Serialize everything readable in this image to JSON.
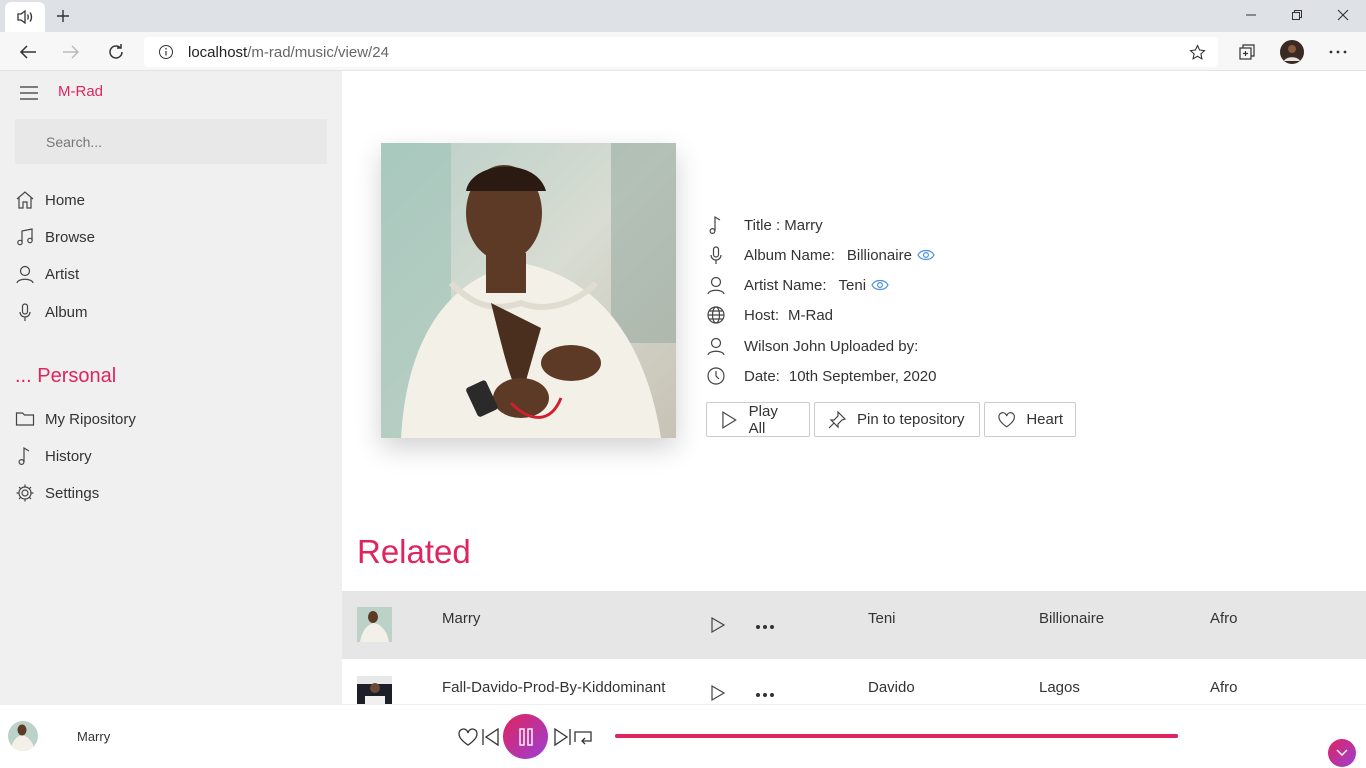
{
  "browser": {
    "tab_icon": "speaker-icon",
    "url_host": "localhost",
    "url_path": "/m-rad/music/view/24"
  },
  "sidebar": {
    "brand": "M-Rad",
    "search_placeholder": "Search...",
    "nav": [
      {
        "label": "Home",
        "icon": "home-icon"
      },
      {
        "label": "Browse",
        "icon": "music-note-icon"
      },
      {
        "label": "Artist",
        "icon": "person-icon"
      },
      {
        "label": "Album",
        "icon": "microphone-icon"
      }
    ],
    "personal_heading": "... Personal",
    "personal": [
      {
        "label": "My Ripository",
        "icon": "folder-icon"
      },
      {
        "label": "History",
        "icon": "music-note-icon"
      },
      {
        "label": "Settings",
        "icon": "gear-icon"
      }
    ]
  },
  "song": {
    "title_label": "Title : Marry",
    "album_label": "Album Name:",
    "album_value": "Billionaire",
    "artist_label": "Artist Name:",
    "artist_value": "Teni",
    "host_label": "Host:",
    "host_value": "M-Rad",
    "uploader_text": "Wilson John Uploaded by:",
    "date_label": "Date:",
    "date_value": "10th September, 2020"
  },
  "actions": {
    "play_all": "Play All",
    "pin": "Pin to tepository",
    "heart": "Heart"
  },
  "related": {
    "title": "Related",
    "rows": [
      {
        "title": "Marry",
        "artist": "Teni",
        "album": "Billionaire",
        "genre": "Afro"
      },
      {
        "title": "Fall-Davido-Prod-By-Kiddominant",
        "artist": "Davido",
        "album": "Lagos",
        "genre": "Afro"
      }
    ]
  },
  "player": {
    "now_playing": "Marry",
    "progress": 1.0
  },
  "colors": {
    "accent": "#e0245e",
    "gradient_end": "#9b3fd6",
    "sidebar_bg": "#f0f0f0",
    "row_highlight": "#e6e6e6"
  }
}
